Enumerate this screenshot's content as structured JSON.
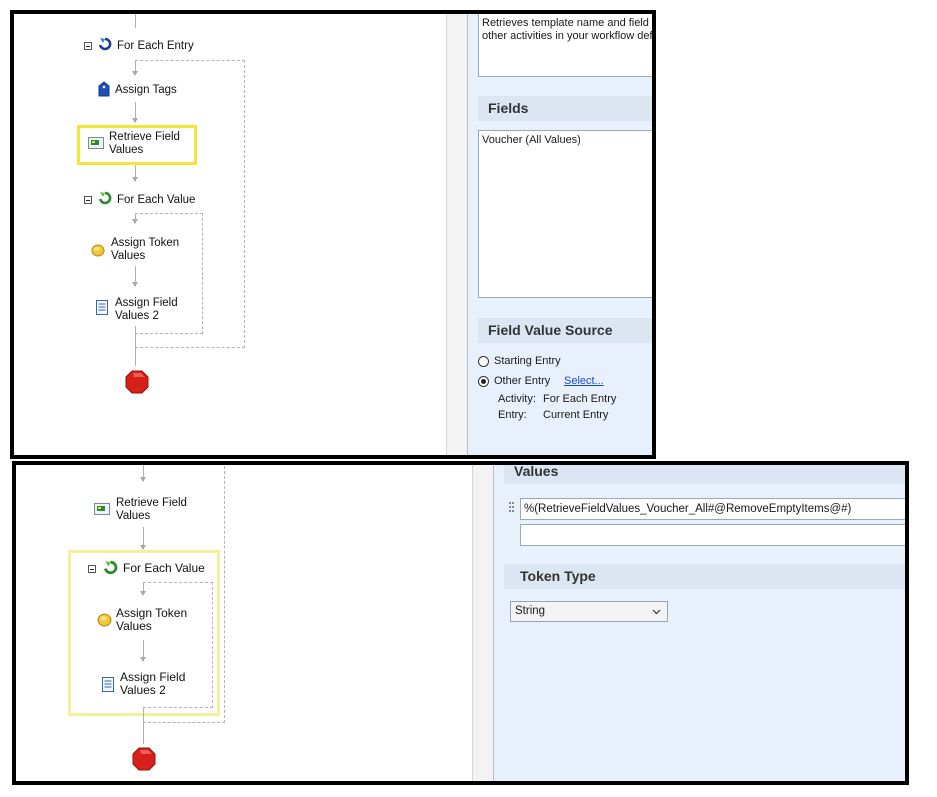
{
  "top_panel": {
    "workflow": {
      "for_each_entry": "For Each Entry",
      "assign_tags": "Assign Tags",
      "retrieve_field_values_line1": "Retrieve Field",
      "retrieve_field_values_line2": "Values",
      "for_each_value": "For Each Value",
      "assign_token_values_line1": "Assign Token",
      "assign_token_values_line2": "Values",
      "assign_field_values_line1": "Assign Field",
      "assign_field_values_line2": "Values 2"
    },
    "properties": {
      "description_line1": "Retrieves template name and field va",
      "description_line2": "other activities in your workflow defin",
      "fields_title": "Fields",
      "fields_value": "Voucher (All Values)",
      "field_value_source_title": "Field Value Source",
      "starting_entry_label": "Starting Entry",
      "other_entry_label": "Other Entry",
      "select_link": "Select...",
      "activity_label": "Activity:",
      "activity_value": "For Each Entry",
      "entry_label": "Entry:",
      "entry_value": "Current Entry"
    }
  },
  "bottom_panel": {
    "workflow": {
      "retrieve_field_values_line1": "Retrieve Field",
      "retrieve_field_values_line2": "Values",
      "for_each_value": "For Each Value",
      "assign_token_values_line1": "Assign Token",
      "assign_token_values_line2": "Values",
      "assign_field_values_line1": "Assign Field",
      "assign_field_values_line2": "Values 2"
    },
    "properties": {
      "values_title": "Values",
      "value_row_1": "%(RetrieveFieldValues_Voucher_All#@RemoveEmptyItems@#)",
      "value_row_2": "",
      "token_type_title": "Token Type",
      "token_type_selected": "String"
    }
  },
  "colors": {
    "highlight": "#f2e63a",
    "highlight_pale": "#f5ee9a",
    "link": "#1a47d6",
    "panel_bg": "#e8f1fb"
  }
}
